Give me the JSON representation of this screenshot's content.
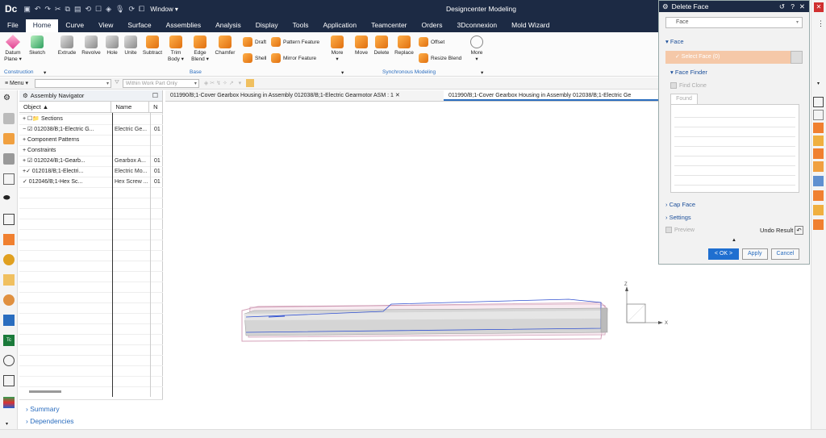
{
  "titlebar": {
    "logo": "Dc",
    "window_menu": "Window ▾",
    "app_title": "Designcenter Modeling"
  },
  "menu": {
    "tabs": [
      "File",
      "Home",
      "Curve",
      "View",
      "Surface",
      "Assemblies",
      "Analysis",
      "Display",
      "Tools",
      "Application",
      "Teamcenter",
      "Orders",
      "3Dconnexion",
      "Mold Wizard"
    ],
    "active": "Home"
  },
  "ribbon": {
    "datum_plane": "Datum",
    "datum_plane2": "Plane ▾",
    "sketch": "Sketch",
    "extrude": "Extrude",
    "revolve": "Revolve",
    "hole": "Hole",
    "unite": "Unite",
    "subtract": "Subtract",
    "trim_body": "Trim",
    "trim_body2": "Body ▾",
    "edge_blend": "Edge",
    "edge_blend2": "Blend ▾",
    "chamfer": "Chamfer",
    "draft": "Draft",
    "shell": "Shell",
    "pattern_feature": "Pattern Feature",
    "mirror_feature": "Mirror Feature",
    "more": "More",
    "move": "Move",
    "delete": "Delete",
    "replace": "Replace",
    "offset": "Offset",
    "resize_blend": "Resize Blend",
    "more2": "More",
    "group_construction": "Construction",
    "group_base": "Base",
    "group_sync": "Synchronous Modeling"
  },
  "toolbar2": {
    "menu_label": "≡ Menu ▾",
    "filter_placeholder": "Within Work Part Only"
  },
  "navigator": {
    "title": "Assembly Navigator",
    "columns": [
      "Object ▲",
      "Name",
      "N"
    ],
    "rows": [
      {
        "object": "+ ☐📁 Sections",
        "name": "",
        "n": ""
      },
      {
        "object": "− ☑ 012038/B;1-Electric G...",
        "name": "Electric Ge...",
        "n": "01"
      },
      {
        "object": "   + Component Patterns",
        "name": "",
        "n": ""
      },
      {
        "object": "   + Constraints",
        "name": "",
        "n": ""
      },
      {
        "object": "   + ☑ 012024/B;1-Gearb...",
        "name": "Gearbox A...",
        "n": "01"
      },
      {
        "object": "   +✓ 012018/B;1-Electri...",
        "name": "Electric Mo...",
        "n": "01"
      },
      {
        "object": "    ✓ 012046/B;1-Hex Sc...",
        "name": "Hex Screw ...",
        "n": "01"
      }
    ],
    "footer": [
      "Summary",
      "Dependencies"
    ]
  },
  "graphics_tabs": [
    "011990/B;1-Cover Gearbox Housing in Assembly 012038/B;1-Electric Gearmotor ASM : 1 ✕",
    "011990/B;1-Cover Gearbox Housing in Assembly 012038/B;1-Electric Ge"
  ],
  "axes": {
    "x": "X",
    "z": "Z"
  },
  "dialog": {
    "title": "Delete Face",
    "controls": [
      "↺",
      "?",
      "✕"
    ],
    "filter": "Face",
    "sec_face": "▾ Face",
    "select_face": "✓ Select Face (0)",
    "sec_face_finder": "▾ Face Finder",
    "find_clone": "Find Clone",
    "found_tab": "Found",
    "sec_cap_face": "› Cap Face",
    "sec_settings": "› Settings",
    "preview": "Preview",
    "undo_result": "Undo Result",
    "ok": "< OK >",
    "apply": "Apply",
    "cancel": "Cancel"
  }
}
